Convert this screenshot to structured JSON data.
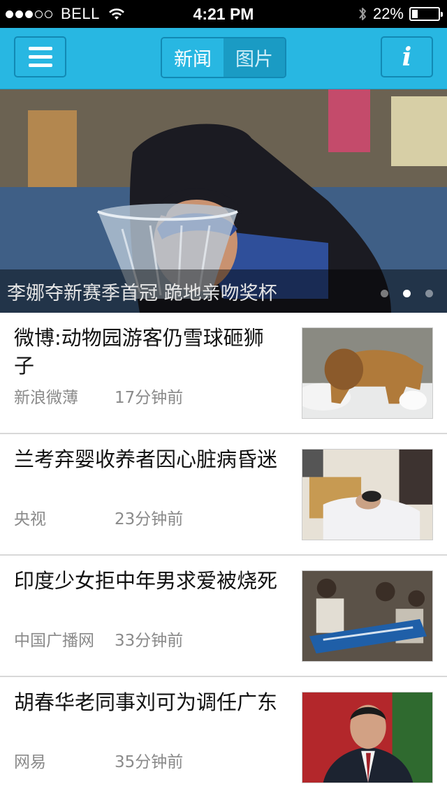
{
  "status_bar": {
    "signal_filled": 3,
    "signal_total": 5,
    "carrier": "BELL",
    "time": "4:21 PM",
    "battery_text": "22%",
    "battery_level": 0.22
  },
  "nav": {
    "tabs": [
      {
        "label": "新闻",
        "active": true
      },
      {
        "label": "图片",
        "active": false
      }
    ],
    "info_label": "i",
    "accent_color": "#28b7e2"
  },
  "hero": {
    "caption": "李娜夺新赛季首冠 跪地亲吻奖杯",
    "page_count": 3,
    "active_page": 2
  },
  "news": [
    {
      "title": "微博:动物园游客仍雪球砸狮子",
      "source": "新浪微薄",
      "time": "17分钟前",
      "thumb": "lion-in-snow"
    },
    {
      "title": "兰考弃婴收养者因心脏病昏迷",
      "source": "央视",
      "time": "23分钟前",
      "thumb": "person-in-hospital-bed"
    },
    {
      "title": "印度少女拒中年男求爱被烧死",
      "source": "中国广播网",
      "time": "33分钟前",
      "thumb": "stretcher-crowd"
    },
    {
      "title": "胡春华老同事刘可为调任广东",
      "source": "网易",
      "time": "35分钟前",
      "thumb": "official-portrait"
    }
  ]
}
